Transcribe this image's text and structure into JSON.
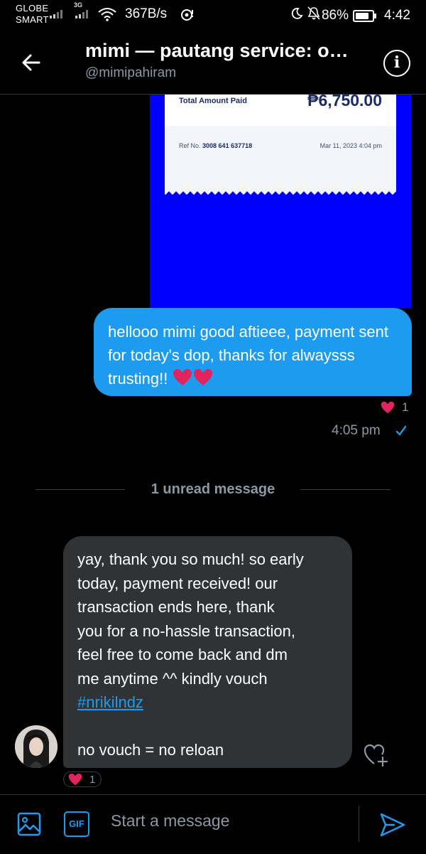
{
  "status_bar": {
    "carrier_1": "GLOBE",
    "carrier_2": "SMART",
    "network": "3G",
    "net_speed": "367B/s",
    "battery": "86%",
    "time": "4:42"
  },
  "header": {
    "title": "mimi — pautang service: o…",
    "handle": "@mimipahiram",
    "info_icon": "i"
  },
  "receipt": {
    "amount_label": "Total Amount Paid",
    "amount_value": "₱6,750.00",
    "ref_label": "Ref No.",
    "ref_number": "3008 641 637718",
    "date": "Mar 11, 2023 4:04 pm",
    "background_color": "#0000fe"
  },
  "sent_message": {
    "text": "hellooo mimi good aftieee, payment sent for today's dop, thanks for alwaysss trusting!!",
    "reaction_count": "1",
    "time": "4:05 pm",
    "color": "#1d9bf0"
  },
  "divider": {
    "label": "1 unread message"
  },
  "received_message": {
    "lines": [
      "yay, thank you so much! so early",
      "today, payment received! our",
      "transaction ends here, thank",
      "you for a no-hassle transaction,",
      "feel free to come back and dm",
      "me anytime ^^ kindly vouch"
    ],
    "hashtag": "#nrikilndz",
    "last_line": "no vouch = no reloan",
    "reaction_count": "1",
    "color": "#2f3336"
  },
  "composer": {
    "placeholder": "Start a message",
    "gif_label": "GIF"
  },
  "icons": {
    "back": "arrow-left-icon",
    "info": "info-icon",
    "image": "image-icon",
    "gif": "gif-icon",
    "send": "send-icon",
    "react": "heart-plus-icon",
    "heart": "heart-icon",
    "check": "check-icon"
  }
}
